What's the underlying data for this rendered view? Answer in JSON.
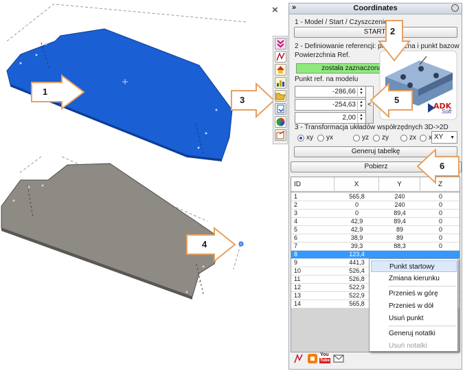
{
  "window": {
    "title": "Coordinates",
    "collapse_glyph": "»",
    "close_glyph": "×"
  },
  "callouts": [
    "1",
    "2",
    "3",
    "4",
    "5",
    "6"
  ],
  "section1": {
    "label": "1 - Model / Start / Czyszczenie",
    "start_button": "START!"
  },
  "section2": {
    "label": "2 - Definiowanie referencji: płaszczyzna i punkt bazowy",
    "surface_label": "Powierzchnia Ref.",
    "surface_status": "została zaznaczona",
    "pick_glyph": "<",
    "ref_point_label": "Punkt ref. na modelu",
    "ref_x": "-286,66",
    "ref_y": "-254,63",
    "ref_z": "2,00",
    "logo_text": "ADK",
    "logo_sub": "Soft"
  },
  "section3": {
    "label": "3 - Transformacja układów współrzędnych 3D->2D",
    "radios": [
      {
        "label": "xy",
        "checked": true
      },
      {
        "label": "yx",
        "checked": false
      },
      {
        "label": "yz",
        "checked": false
      },
      {
        "label": "zy",
        "checked": false
      },
      {
        "label": "zx",
        "checked": false
      },
      {
        "label": "xz",
        "checked": false
      }
    ],
    "plane_select": "XY",
    "generate_button": "Generuj tabelkę",
    "fetch_button": "Pobierz"
  },
  "table": {
    "columns": [
      "ID",
      "X",
      "Y",
      "Z"
    ],
    "rows": [
      [
        "1",
        "565,8",
        "240",
        "0"
      ],
      [
        "2",
        "0",
        "240",
        "0"
      ],
      [
        "3",
        "0",
        "89,4",
        "0"
      ],
      [
        "4",
        "42,9",
        "89,4",
        "0"
      ],
      [
        "5",
        "42,9",
        "89",
        "0"
      ],
      [
        "6",
        "38,9",
        "89",
        "0"
      ],
      [
        "7",
        "39,3",
        "88,3",
        "0"
      ],
      [
        "8",
        "123,4",
        "",
        ""
      ],
      [
        "9",
        "441,3",
        "",
        ""
      ],
      [
        "10",
        "526,4",
        "",
        ""
      ],
      [
        "11",
        "526,8",
        "",
        ""
      ],
      [
        "12",
        "522,9",
        "",
        ""
      ],
      [
        "13",
        "522,9",
        "",
        ""
      ],
      [
        "14",
        "565,8",
        "",
        ""
      ]
    ],
    "selected_row": 7
  },
  "context_menu": {
    "items": [
      {
        "label": "Punkt startowy",
        "highlight": true,
        "disabled": false
      },
      {
        "label": "Zmiana kierunku",
        "highlight": false,
        "disabled": false
      },
      {
        "label": "Przenieś w górę",
        "highlight": false,
        "disabled": false
      },
      {
        "label": "Przenieś w dół",
        "highlight": false,
        "disabled": false
      },
      {
        "label": "Usuń punkt",
        "highlight": false,
        "disabled": false
      },
      {
        "label": "Generuj notatki",
        "highlight": false,
        "disabled": false
      },
      {
        "label": "Usuń notatki",
        "highlight": false,
        "disabled": true
      }
    ]
  },
  "colors": {
    "part_blue": "#1c63d9",
    "part_gray": "#8e8b85",
    "arrow_fill": "#ffffff",
    "arrow_stroke": "#e9a25f",
    "status_green": "#8fe97f",
    "row_selected": "#3399ff"
  },
  "icons": {
    "toolbar": [
      "chevrons-down-icon",
      "sketch-icon",
      "home-icon",
      "chart-icon",
      "folder-open-icon",
      "import-icon",
      "color-wheel-icon",
      "export-icon"
    ],
    "bottom": [
      "sketch-icon",
      "blog-icon",
      "youtube-icon",
      "mail-icon"
    ],
    "youtube_line1": "You",
    "youtube_line2": "Tube"
  }
}
